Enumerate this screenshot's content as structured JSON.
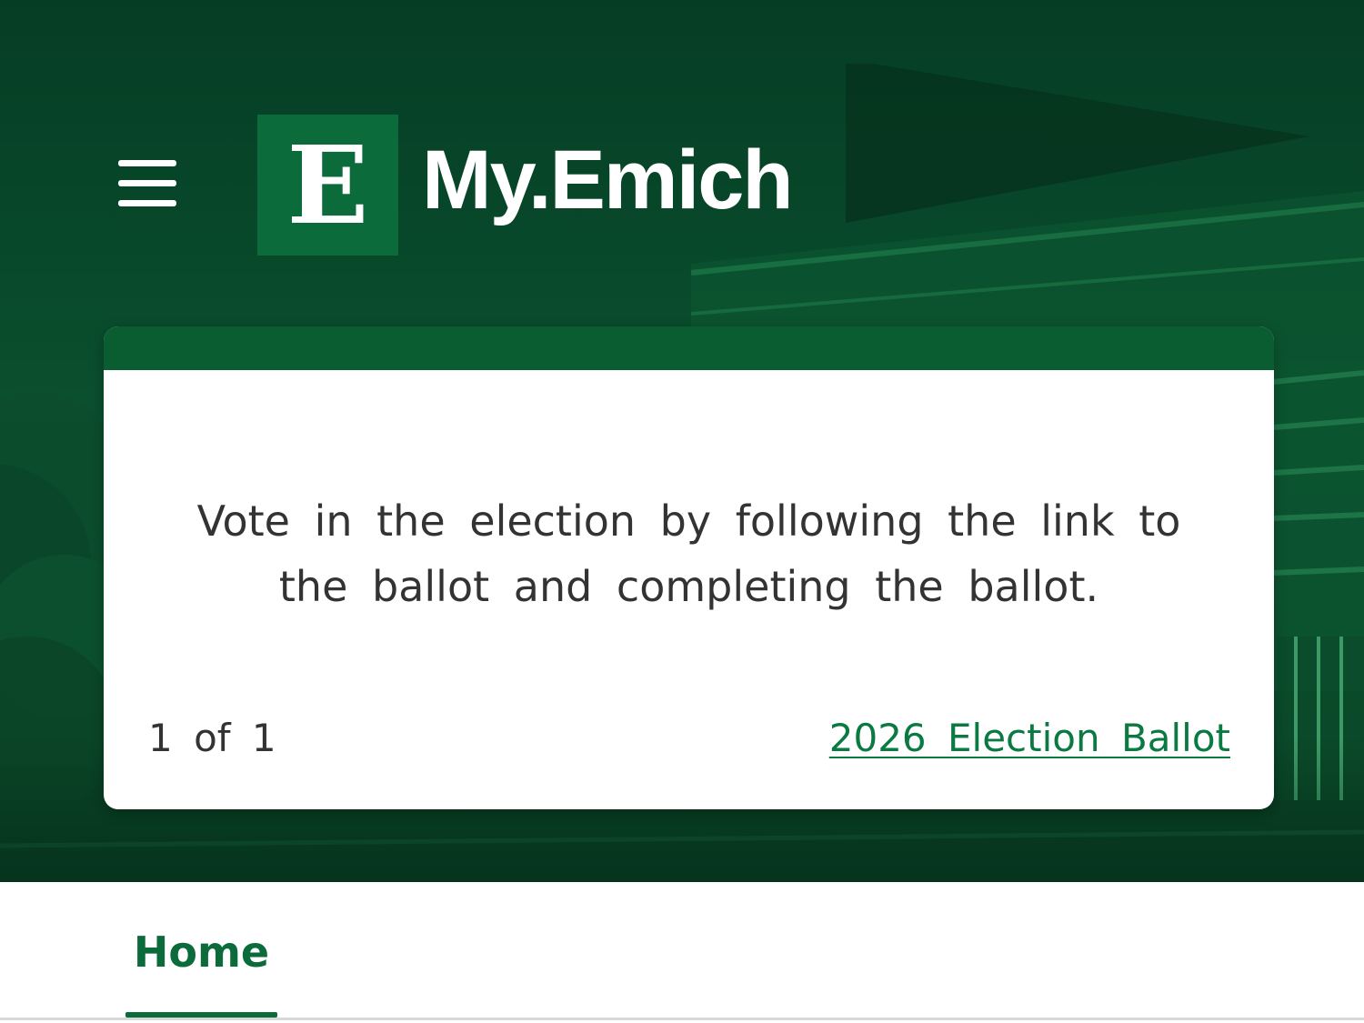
{
  "header": {
    "logo_mark": "E",
    "logo_text": "My.Emich",
    "menu_icon": "hamburger-menu-icon"
  },
  "card": {
    "message": "Vote in the election by following the link to the ballot and completing the ballot.",
    "pager": "1 of 1",
    "link_label": "2026 Election Ballot"
  },
  "tabs": [
    {
      "label": "Home",
      "active": true
    }
  ],
  "colors": {
    "brand_green": "#0b6b3a",
    "card_header": "#0a5c31",
    "link": "#0b7a42",
    "hero_background": "#0a4f2e"
  }
}
